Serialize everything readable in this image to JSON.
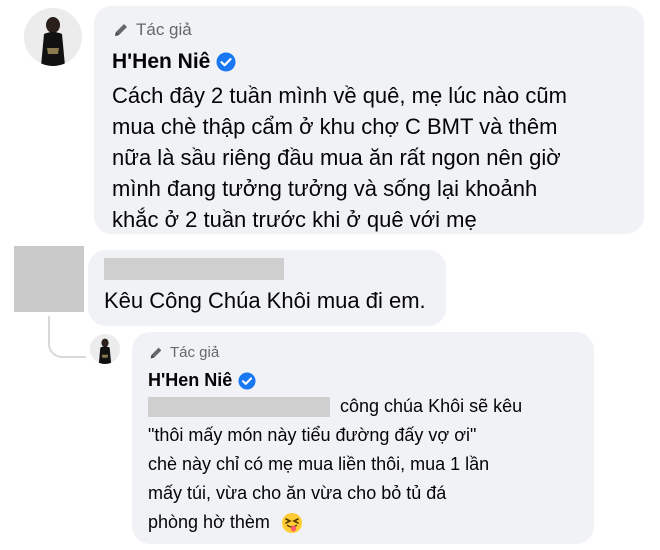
{
  "comment1": {
    "badge": "Tác giả",
    "author": "H'Hen Niê",
    "lines": [
      "Cách đây 2 tuần mình về quê, mẹ lúc nào cũm",
      "mua chè thập cẩm ở khu chợ C BMT và thêm",
      "nữa là sầu riêng đầu mua ăn rất ngon nên giờ",
      "mình đang tưởng tưởng và sống lại khoảnh",
      "khắc ở 2 tuần trước khi ở quê với mẹ"
    ]
  },
  "comment2": {
    "text": "Kêu Công Chúa Khôi mua đi em."
  },
  "reply": {
    "badge": "Tác giả",
    "author": "H'Hen Niê",
    "line1_tail": "công chúa Khôi sẽ kêu",
    "lines": [
      "\"thôi mấy món này tiểu đường đấy vợ ơi\"",
      "chè này chỉ có mẹ mua liền thôi, mua 1 lần",
      "mấy túi, vừa cho ăn vừa cho bỏ tủ đá"
    ],
    "last_line": "phòng hờ thèm",
    "emoji": "squinting-face-with-tongue"
  },
  "colors": {
    "bubble": "#f0f2f5",
    "verified": "#1877f2",
    "muted": "#65676b"
  }
}
